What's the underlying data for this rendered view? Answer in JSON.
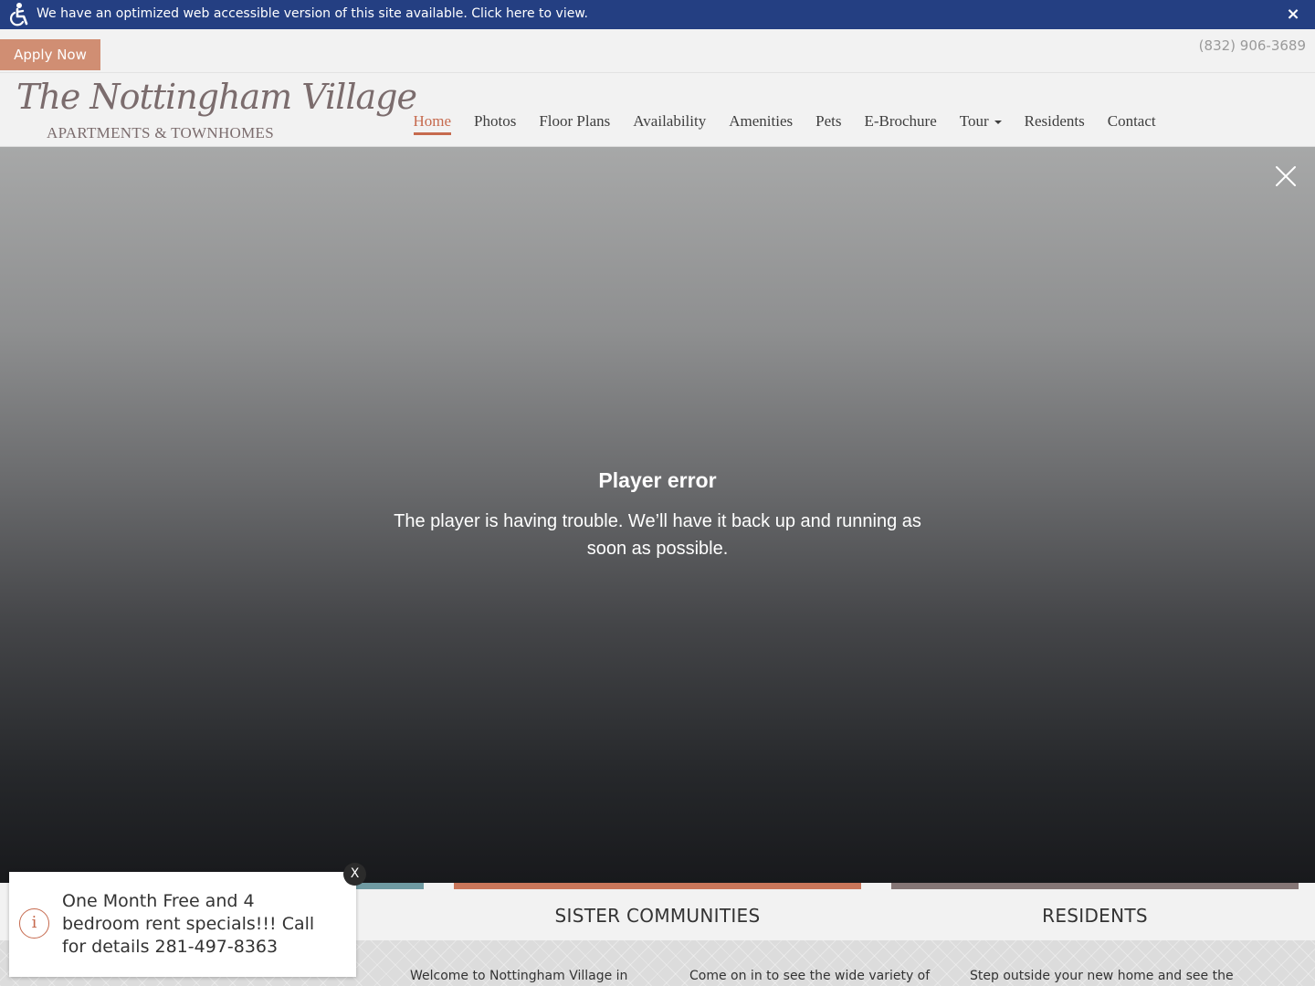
{
  "accessibility_banner": {
    "icon": "accessibility-icon",
    "message": "We have an optimized web accessible version of this site available. Click here to view.",
    "close": "×"
  },
  "utility": {
    "apply_label": "Apply Now",
    "phone": "(832) 906-3689"
  },
  "logo": {
    "name": "The Nottingham Village",
    "tagline": "APARTMENTS & TOWNHOMES"
  },
  "nav": {
    "items": [
      {
        "label": "Home",
        "active": true
      },
      {
        "label": "Photos"
      },
      {
        "label": "Floor Plans"
      },
      {
        "label": "Availability"
      },
      {
        "label": "Amenities"
      },
      {
        "label": "Pets"
      },
      {
        "label": "E-Brochure"
      },
      {
        "label": "Tour",
        "dropdown": true
      },
      {
        "label": "Residents"
      },
      {
        "label": "Contact"
      }
    ]
  },
  "player": {
    "error_title": "Player error",
    "error_message": "The player is having trouble. We’ll have it back up and running as soon as possible."
  },
  "tiles": [
    {
      "title": "",
      "color": "#6f9aa2",
      "text": "Welcome to Nottingham Village in"
    },
    {
      "title": "SISTER COMMUNITIES",
      "color": "#c9765a",
      "text": "Come on in to see the wide variety of"
    },
    {
      "title": "RESIDENTS",
      "color": "#857676",
      "text": "Step outside your new home and see the"
    }
  ],
  "promo": {
    "icon": "info-icon",
    "message": "One Month Free and 4 bedroom rent specials!!! Call for details 281-497-8363",
    "close": "X"
  },
  "colors": {
    "banner_blue": "#243f82",
    "accent": "#c66a4e",
    "apply_button": "#d08e73"
  }
}
